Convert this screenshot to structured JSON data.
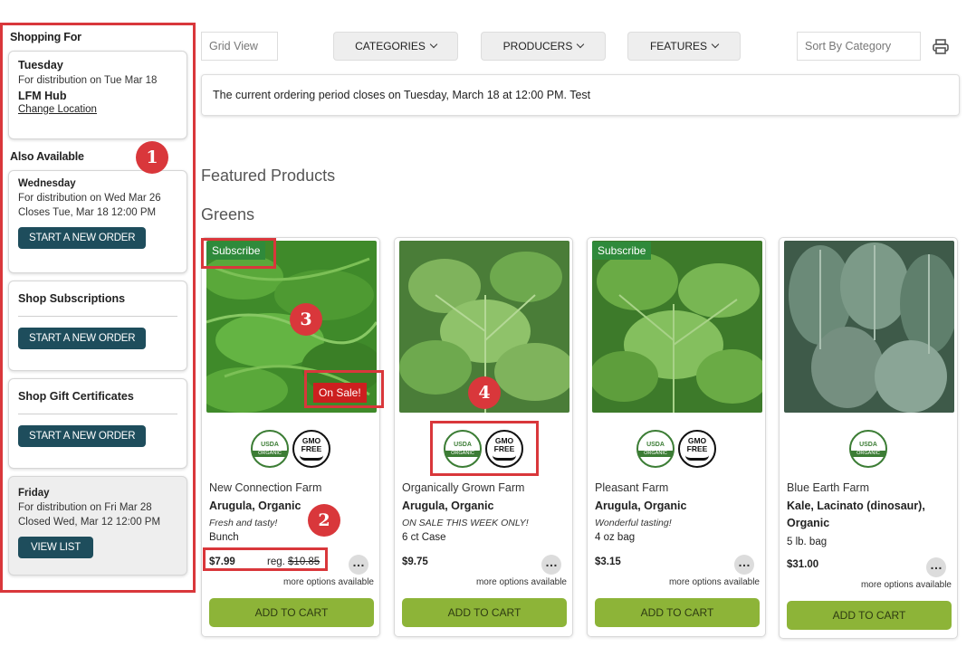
{
  "sidebar": {
    "shopping_for_heading": "Shopping For",
    "current": {
      "day": "Tuesday",
      "distribution": "For distribution on Tue Mar 18",
      "hub": "LFM Hub",
      "change_location": "Change Location"
    },
    "also_available_heading": "Also Available",
    "wednesday": {
      "day": "Wednesday",
      "distribution": "For distribution on Wed Mar 26",
      "closes": "Closes Tue, Mar 18 12:00 PM",
      "button": "START A NEW ORDER"
    },
    "subscriptions": {
      "title": "Shop Subscriptions",
      "button": "START A NEW ORDER"
    },
    "gift": {
      "title": "Shop Gift Certificates",
      "button": "START A NEW ORDER"
    },
    "friday": {
      "day": "Friday",
      "distribution": "For distribution on Fri Mar 28",
      "closed": "Closed Wed, Mar 12 12:00 PM",
      "button": "VIEW LIST"
    }
  },
  "toolbar": {
    "grid_view": "Grid View",
    "categories": "CATEGORIES",
    "producers": "PRODUCERS",
    "features": "FEATURES",
    "sort": "Sort By Category",
    "print_icon": "printer-icon"
  },
  "notice": "The current ordering period closes on Tuesday, March 18 at 12:00 PM. Test",
  "featured_heading": "Featured Products",
  "category_heading": "Greens",
  "products": [
    {
      "subscribe": "Subscribe",
      "on_sale": "On Sale!",
      "farm": "New Connection Farm",
      "name": "Arugula, Organic",
      "note": "Fresh and tasty!",
      "unit": "Bunch",
      "price": "$7.99",
      "reg_label": "reg.",
      "reg_price": "$10.85",
      "more": "more options available",
      "cart": "ADD TO CART"
    },
    {
      "farm": "Organically Grown Farm",
      "name": "Arugula, Organic",
      "note": "ON SALE THIS WEEK ONLY!",
      "unit": "6 ct Case",
      "price": "$9.75",
      "more": "more options available",
      "cart": "ADD TO CART"
    },
    {
      "subscribe": "Subscribe",
      "farm": "Pleasant Farm",
      "name": "Arugula, Organic",
      "note": "Wonderful tasting!",
      "unit": "4 oz bag",
      "price": "$3.15",
      "more": "more options available",
      "cart": "ADD TO CART"
    },
    {
      "farm": "Blue Earth Farm",
      "name": "Kale, Lacinato (dinosaur), Organic",
      "unit": "5 lb. bag",
      "price": "$31.00",
      "more": "more options available",
      "cart": "ADD TO CART"
    }
  ],
  "badges": {
    "usda_top": "USDA",
    "usda_bottom": "ORGANIC",
    "gmo_top": "GMO",
    "gmo_bottom": "FREE"
  },
  "callouts": [
    "1",
    "2",
    "3",
    "4"
  ],
  "colors": {
    "callout_red": "#d9373b",
    "cart_green": "#8db438",
    "dark_button": "#1e4d5c",
    "sale_red": "#cc1f1f",
    "subscribe_green": "#2f8a3b"
  }
}
